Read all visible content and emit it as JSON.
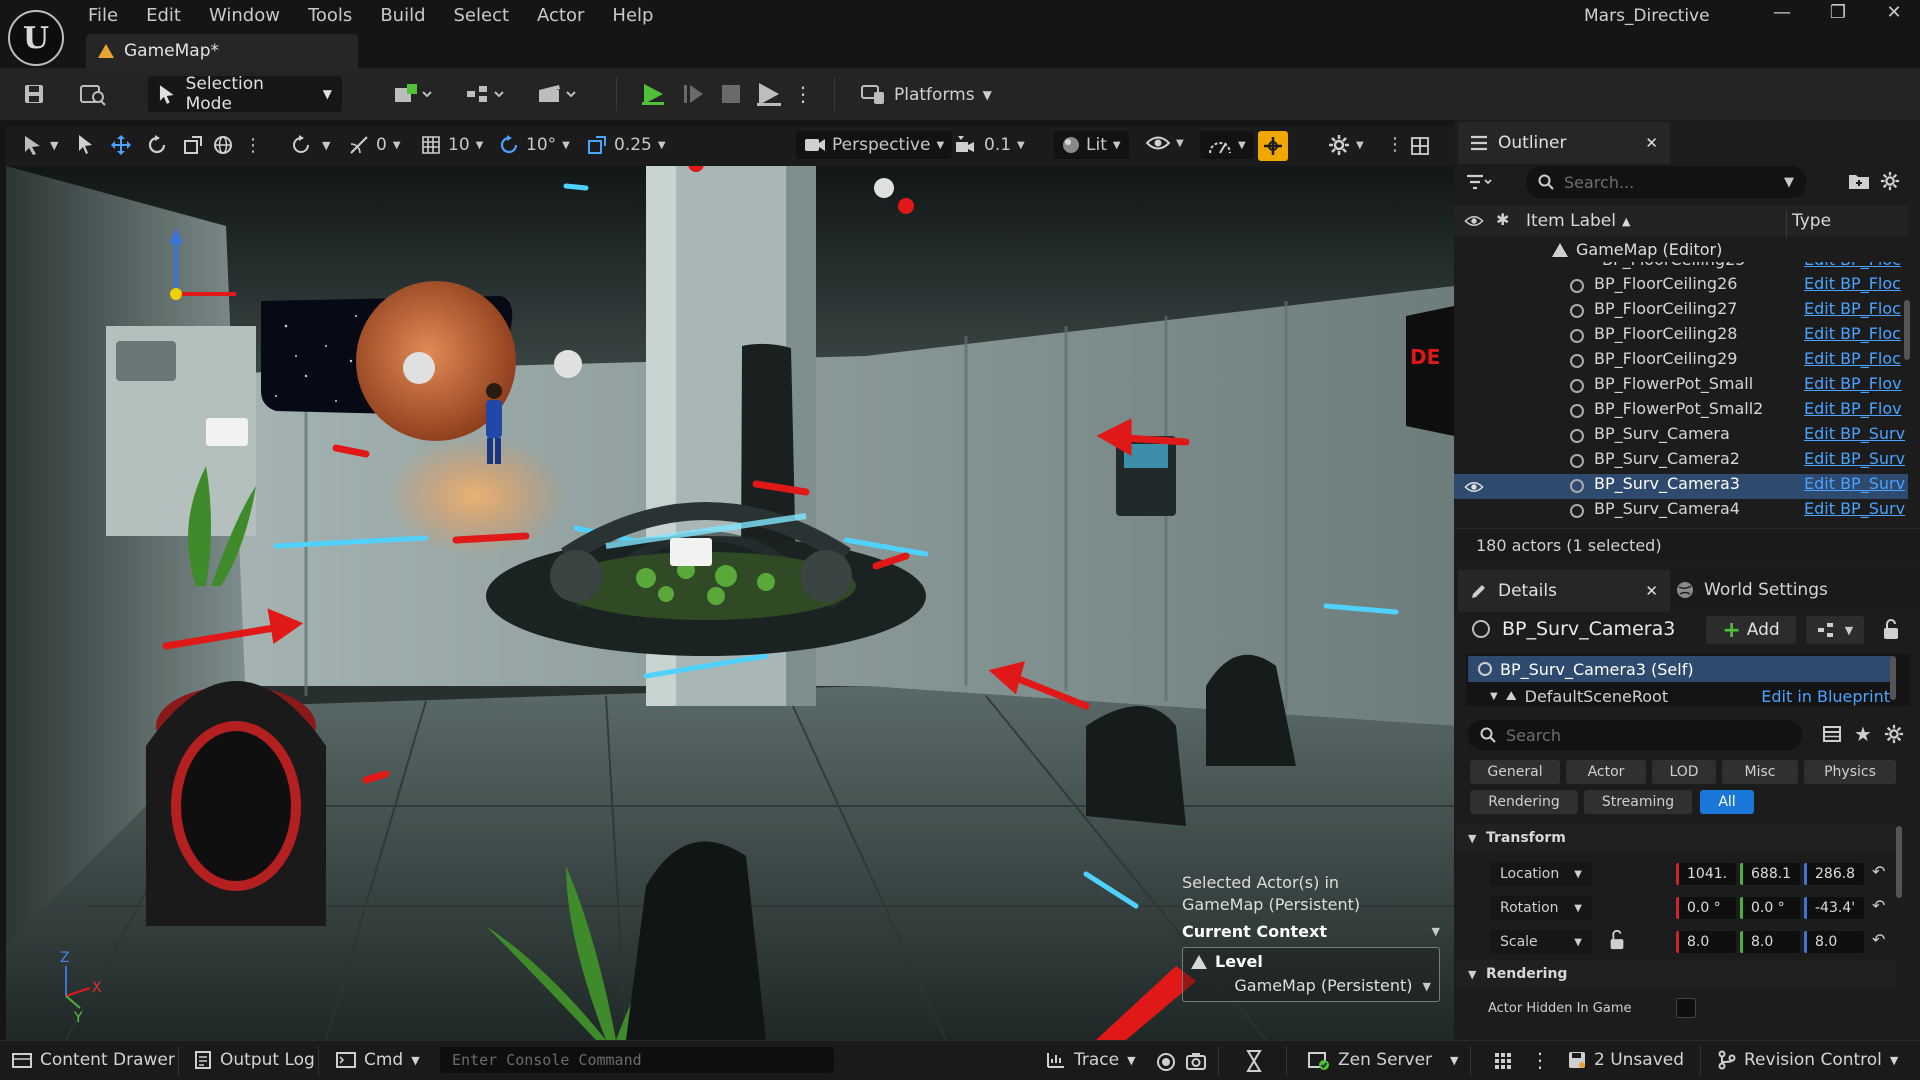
{
  "app": {
    "logo": "U",
    "menu": [
      "File",
      "Edit",
      "Window",
      "Tools",
      "Build",
      "Select",
      "Actor",
      "Help"
    ],
    "doc_tab": "GameMap*",
    "project": "Mars_Directive",
    "window_controls": [
      "—",
      "❐",
      "✕"
    ]
  },
  "toolbar": {
    "selection_mode": "Selection Mode",
    "platforms": "Platforms"
  },
  "viewport_toolbar": {
    "angle_snap_count": "0",
    "grid_snap": "10",
    "rotation_snap": "10°",
    "scale_snap": "0.25",
    "view_mode": "Perspective",
    "camera_speed": "0.1",
    "lighting": "Lit"
  },
  "viewport": {
    "axis_labels": [
      "Z",
      "Y",
      "X"
    ],
    "sign_text": "DE",
    "context": {
      "line1": "Selected Actor(s) in",
      "line2": "GameMap (Persistent)",
      "heading": "Current Context",
      "level_label": "Level",
      "level_value": "GameMap (Persistent)"
    }
  },
  "outliner": {
    "tab": "Outliner",
    "search_placeholder": "Search...",
    "col_label": "Item Label",
    "col_type": "Type",
    "root": "GameMap (Editor)",
    "rows": [
      {
        "name": "BP_FloorCeiling26",
        "type": "Edit BP_Floc"
      },
      {
        "name": "BP_FloorCeiling27",
        "type": "Edit BP_Floc"
      },
      {
        "name": "BP_FloorCeiling28",
        "type": "Edit BP_Floc"
      },
      {
        "name": "BP_FloorCeiling29",
        "type": "Edit BP_Floc"
      },
      {
        "name": "BP_FlowerPot_Small",
        "type": "Edit BP_Flov"
      },
      {
        "name": "BP_FlowerPot_Small2",
        "type": "Edit BP_Flov"
      },
      {
        "name": "BP_Surv_Camera",
        "type": "Edit BP_Surv"
      },
      {
        "name": "BP_Surv_Camera2",
        "type": "Edit BP_Surv"
      },
      {
        "name": "BP_Surv_Camera3",
        "type": "Edit BP_Surv",
        "selected": true
      },
      {
        "name": "BP_Surv_Camera4",
        "type": "Edit BP_Surv"
      }
    ],
    "footer": "180 actors (1 selected)"
  },
  "details": {
    "tab": "Details",
    "tab2": "World Settings",
    "actor_name": "BP_Surv_Camera3",
    "add_label": "Add",
    "component_self": "BP_Surv_Camera3 (Self)",
    "component_root": "DefaultSceneRoot",
    "edit_blueprint": "Edit in Blueprint",
    "search_placeholder": "Search",
    "categories_row1": [
      "General",
      "Actor",
      "LOD",
      "Misc",
      "Physics"
    ],
    "categories_row2": [
      "Rendering",
      "Streaming",
      "All"
    ],
    "transform_header": "Transform",
    "location": {
      "label": "Location",
      "x": "1041.",
      "y": "688.1",
      "z": "286.8"
    },
    "rotation": {
      "label": "Rotation",
      "x": "0.0 °",
      "y": "0.0 °",
      "z": "-43.4'"
    },
    "scale": {
      "label": "Scale",
      "x": "8.0",
      "y": "8.0",
      "z": "8.0"
    },
    "rendering_header": "Rendering",
    "actor_hidden": "Actor Hidden In Game"
  },
  "statusbar": {
    "content_drawer": "Content Drawer",
    "output_log": "Output Log",
    "cmd": "Cmd",
    "console_placeholder": "Enter Console Command",
    "trace": "Trace",
    "zen_server": "Zen Server",
    "unsaved": "2 Unsaved",
    "revision_control": "Revision Control"
  },
  "colors": {
    "accent_blue": "#4aa3ff",
    "selected_row": "#2e4a6e",
    "play_green": "#4fc23a",
    "snap_orange": "#f0a800"
  }
}
